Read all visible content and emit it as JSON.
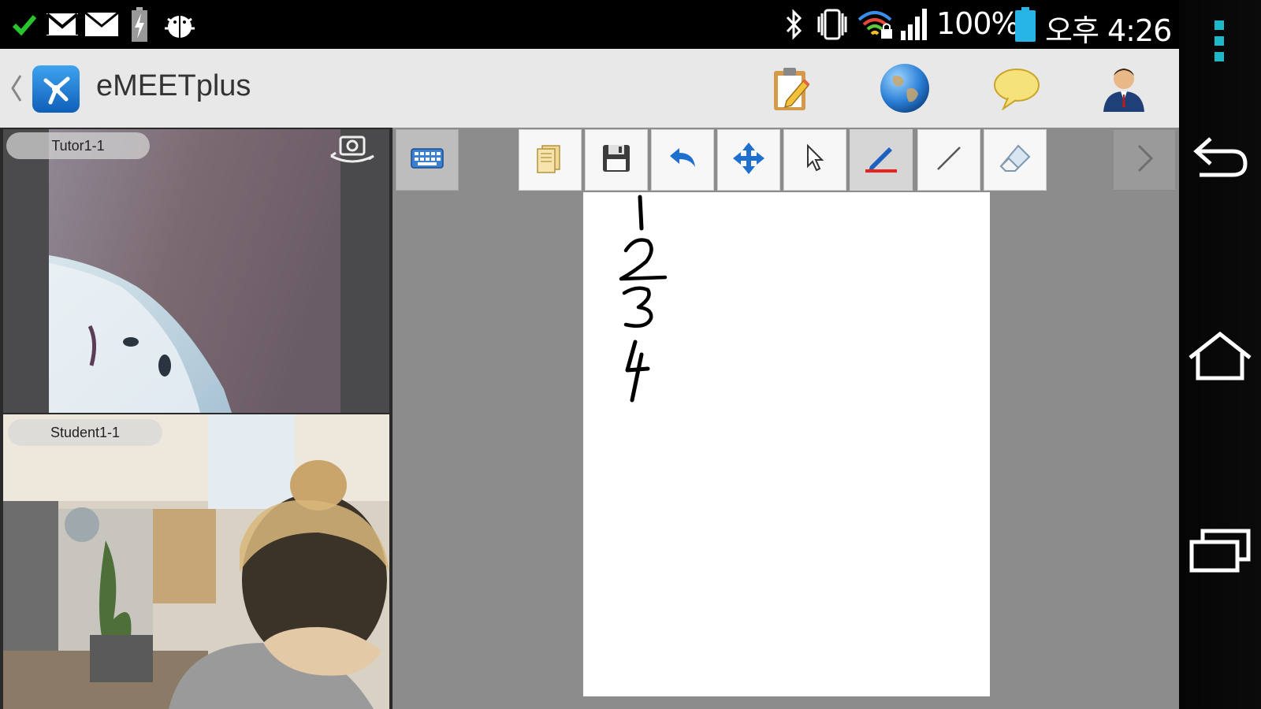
{
  "status_bar": {
    "battery_percent": "100%",
    "time": "오후 4:26",
    "icons": [
      "check-icon",
      "gmail-icon",
      "email-icon",
      "battery-charging-icon",
      "android-debug-icon",
      "bluetooth-icon",
      "vibrate-icon",
      "wifi-lock-icon",
      "signal-icon",
      "battery-icon"
    ]
  },
  "action_bar": {
    "title": "eMEETplus",
    "actions": [
      "clipboard-icon",
      "globe-icon",
      "chat-icon",
      "user-icon"
    ]
  },
  "video": {
    "tutor_label": "Tutor1-1",
    "student_label": "Student1-1"
  },
  "whiteboard": {
    "tools": [
      "folder-icon",
      "save-icon",
      "undo-icon",
      "move-icon",
      "pointer-icon",
      "pen-icon",
      "line-icon",
      "eraser-icon"
    ],
    "active_tool": "pen",
    "pen_color": "#e8201e",
    "handwriting": [
      "1",
      "2",
      "3",
      "4"
    ]
  },
  "colors": {
    "accent_blue": "#1a73c8",
    "action_bar_bg": "#e8e8e8",
    "board_bg": "#8c8c8c"
  }
}
